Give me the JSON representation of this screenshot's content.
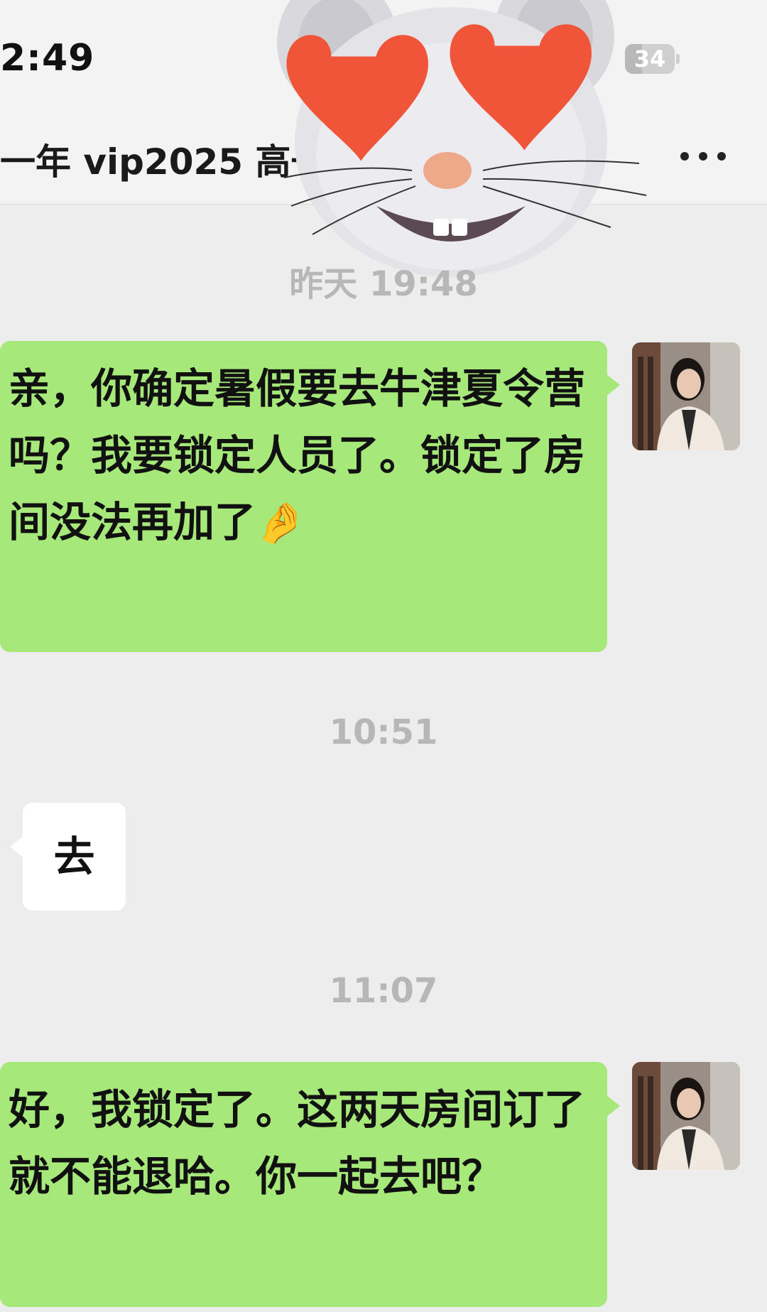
{
  "status_bar": {
    "time": "2:49",
    "battery": "34",
    "battery_level_percent": 34
  },
  "header": {
    "title": "一年 vip2025 高一",
    "more_icon": "more-dots-icon"
  },
  "messages": [
    {
      "type": "timestamp",
      "text": "昨天 19:48"
    },
    {
      "type": "outgoing",
      "text": "亲，你确定暑假要去牛津夏令营吗？我要锁定人员了。锁定了房间没法再加了",
      "emoji": "🤌"
    },
    {
      "type": "timestamp",
      "text": "10:51"
    },
    {
      "type": "incoming",
      "text": "去"
    },
    {
      "type": "timestamp",
      "text": "11:07"
    },
    {
      "type": "outgoing",
      "text": "好，我锁定了。这两天房间订了就不能退哈。你一起去吧？"
    }
  ],
  "colors": {
    "background": "#ededed",
    "outgoing_bubble": "#a6e87a",
    "incoming_bubble": "#ffffff",
    "timestamp_text": "#b7b7b7"
  },
  "sticker": "heart-eyes-mouse-sticker"
}
